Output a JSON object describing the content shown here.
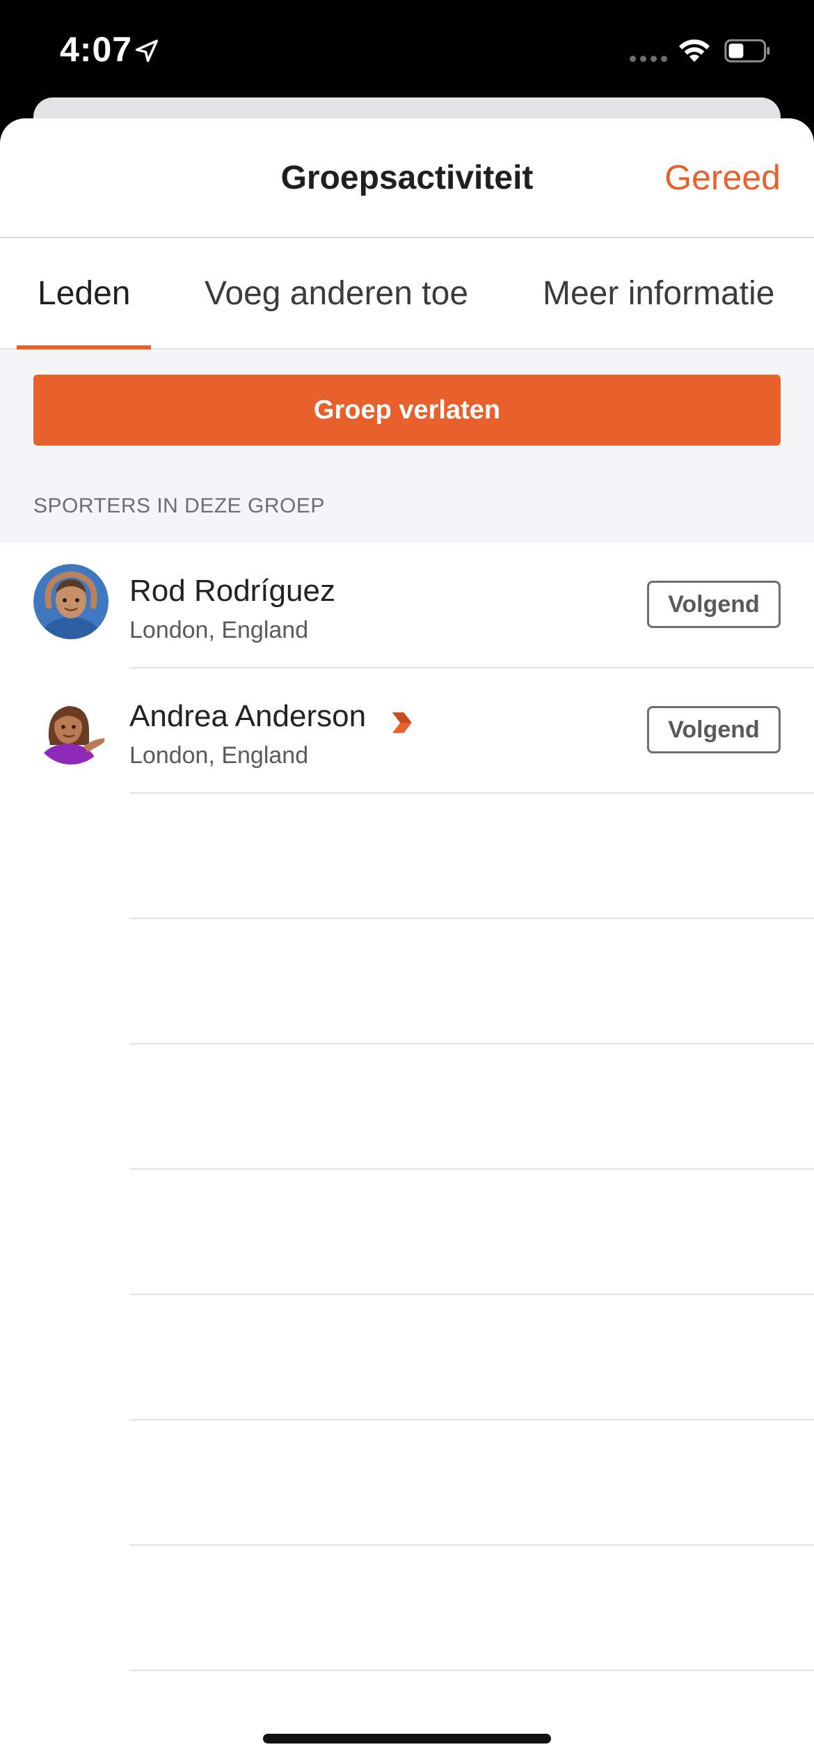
{
  "status_bar": {
    "time": "4:07"
  },
  "header": {
    "title": "Groepsactiviteit",
    "done_label": "Gereed"
  },
  "tabs": [
    {
      "label": "Leden",
      "active": true
    },
    {
      "label": "Voeg anderen toe",
      "active": false
    },
    {
      "label": "Meer informatie",
      "active": false
    }
  ],
  "group": {
    "leave_label": "Groep verlaten",
    "section_header": "SPORTERS IN DEZE GROEP"
  },
  "members": [
    {
      "name": "Rod Rodríguez",
      "location": "London, England",
      "follow_label": "Volgend",
      "avatar_icon": "man-hands-on-head-emoji-icon",
      "badge": false
    },
    {
      "name": "Andrea Anderson",
      "location": "London, England",
      "follow_label": "Volgend",
      "avatar_icon": "woman-tipping-hand-emoji-icon",
      "badge": true
    }
  ],
  "colors": {
    "accent": "#e8602c",
    "section_bg": "#f5f5f7"
  }
}
